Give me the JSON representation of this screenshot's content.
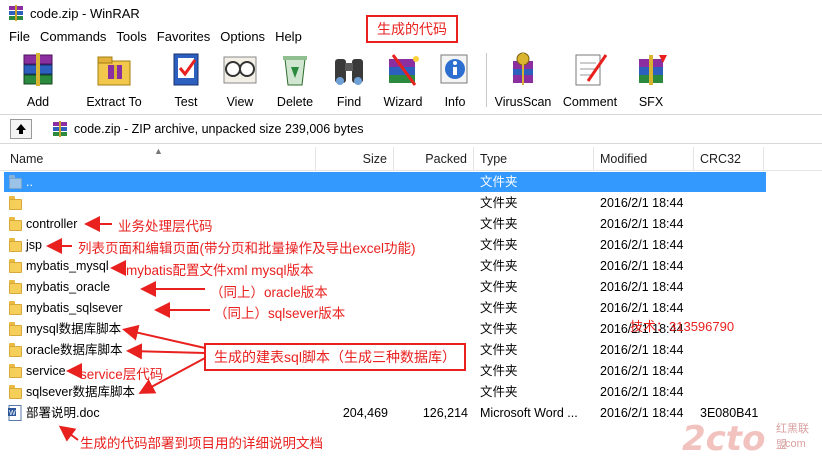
{
  "window": {
    "title": "code.zip - WinRAR"
  },
  "menu": [
    "File",
    "Commands",
    "Tools",
    "Favorites",
    "Options",
    "Help"
  ],
  "toolbar": [
    {
      "label": "Add",
      "icon": "add-books-icon"
    },
    {
      "label": "Extract To",
      "icon": "extract-folder-icon"
    },
    {
      "label": "Test",
      "icon": "test-check-icon"
    },
    {
      "label": "View",
      "icon": "view-glasses-icon"
    },
    {
      "label": "Delete",
      "icon": "delete-recycle-icon"
    },
    {
      "label": "Find",
      "icon": "find-binoculars-icon"
    },
    {
      "label": "Wizard",
      "icon": "wizard-icon"
    },
    {
      "label": "Info",
      "icon": "info-icon"
    },
    {
      "label": "VirusScan",
      "icon": "virusscan-icon"
    },
    {
      "label": "Comment",
      "icon": "comment-pen-icon"
    },
    {
      "label": "SFX",
      "icon": "sfx-archive-icon"
    }
  ],
  "address": {
    "text": "code.zip - ZIP archive, unpacked size 239,006 bytes"
  },
  "columns": [
    "Name",
    "Size",
    "Packed",
    "Type",
    "Modified",
    "CRC32"
  ],
  "files": [
    {
      "name": "..",
      "size": "",
      "packed": "",
      "type": "文件夹",
      "modified": "",
      "crc": "",
      "kind": "folder",
      "selected": true
    },
    {
      "name": "",
      "size": "",
      "packed": "",
      "type": "文件夹",
      "modified": "2016/2/1 18:44",
      "crc": "",
      "kind": "folder"
    },
    {
      "name": "controller",
      "size": "",
      "packed": "",
      "type": "文件夹",
      "modified": "2016/2/1 18:44",
      "crc": "",
      "kind": "folder"
    },
    {
      "name": "jsp",
      "size": "",
      "packed": "",
      "type": "文件夹",
      "modified": "2016/2/1 18:44",
      "crc": "",
      "kind": "folder"
    },
    {
      "name": "mybatis_mysql",
      "size": "",
      "packed": "",
      "type": "文件夹",
      "modified": "2016/2/1 18:44",
      "crc": "",
      "kind": "folder"
    },
    {
      "name": "mybatis_oracle",
      "size": "",
      "packed": "",
      "type": "文件夹",
      "modified": "2016/2/1 18:44",
      "crc": "",
      "kind": "folder"
    },
    {
      "name": "mybatis_sqlsever",
      "size": "",
      "packed": "",
      "type": "文件夹",
      "modified": "2016/2/1 18:44",
      "crc": "",
      "kind": "folder"
    },
    {
      "name": "mysql数据库脚本",
      "size": "",
      "packed": "",
      "type": "文件夹",
      "modified": "2016/2/1 18:44",
      "crc": "",
      "kind": "folder"
    },
    {
      "name": "oracle数据库脚本",
      "size": "",
      "packed": "",
      "type": "文件夹",
      "modified": "2016/2/1 18:44",
      "crc": "",
      "kind": "folder"
    },
    {
      "name": "service",
      "size": "",
      "packed": "",
      "type": "文件夹",
      "modified": "2016/2/1 18:44",
      "crc": "",
      "kind": "folder"
    },
    {
      "name": "sqlsever数据库脚本",
      "size": "",
      "packed": "",
      "type": "文件夹",
      "modified": "2016/2/1 18:44",
      "crc": "",
      "kind": "folder"
    },
    {
      "name": "部署说明.doc",
      "size": "204,469",
      "packed": "126,214",
      "type": "Microsoft Word ...",
      "modified": "2016/2/1 18:44",
      "crc": "3E080B41",
      "kind": "doc"
    }
  ],
  "annotations": {
    "generated_code": "生成的代码",
    "controller": "业务处理层代码",
    "jsp": "列表页面和编辑页面(带分页和批量操作及导出excel功能)",
    "mybatis_mysql": "mybatis配置文件xml  mysql版本",
    "mybatis_oracle": "（同上）oracle版本",
    "mybatis_sqlsever": "（同上）sqlsever版本",
    "scripts": "生成的建表sql脚本（生成三种数据库）",
    "service": "service层代码",
    "doc": "生成的代码部署到项目用的详细说明文档",
    "tech": "技术：313596790"
  },
  "watermark": {
    "logo": "2cto",
    "cn": "红黑联盟",
    "url": ".com"
  },
  "colors": {
    "annotation": "#e8211f",
    "selection": "#3399ff",
    "folder": "#f6cf5a"
  }
}
